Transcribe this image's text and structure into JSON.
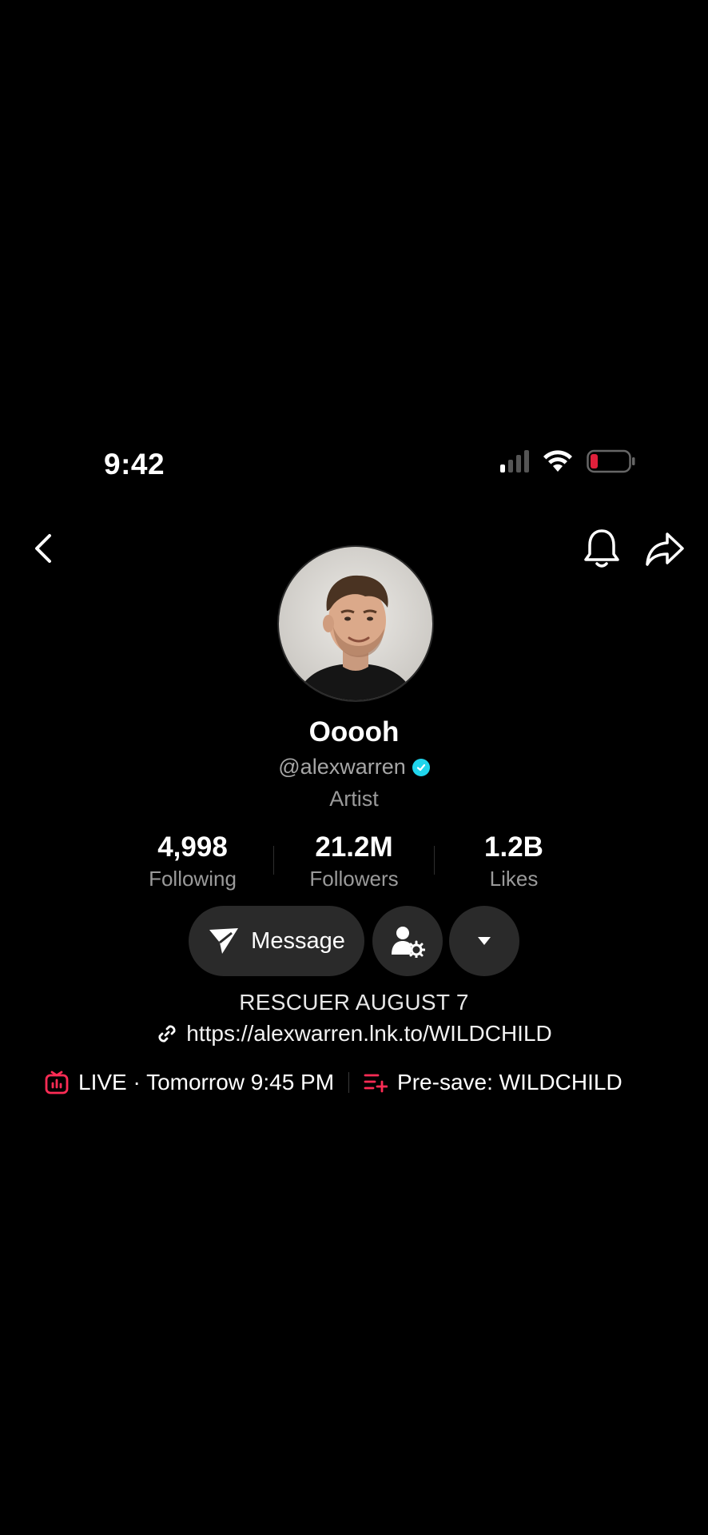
{
  "status_bar": {
    "time": "9:42",
    "battery_color": "#e0203b"
  },
  "nav": {
    "back_icon": "chevron-left-icon",
    "bell_icon": "bell-icon",
    "share_icon": "share-arrow-icon"
  },
  "profile": {
    "display_name": "Ooooh",
    "handle": "@alexwarren",
    "verified": true,
    "category": "Artist"
  },
  "stats": [
    {
      "value": "4,998",
      "label": "Following"
    },
    {
      "value": "21.2M",
      "label": "Followers"
    },
    {
      "value": "1.2B",
      "label": "Likes"
    }
  ],
  "actions": {
    "message_label": "Message",
    "add_friend_icon": "person-gear-icon",
    "more_icon": "caret-down-icon"
  },
  "bio": {
    "text": "RESCUER AUGUST 7",
    "link": "https://alexwarren.lnk.to/WILDCHILD"
  },
  "chips": {
    "live": "LIVE · Tomorrow 9:45 PM",
    "presave": "Pre-save: WILDCHILD",
    "accent_color": "#fe2c55"
  }
}
